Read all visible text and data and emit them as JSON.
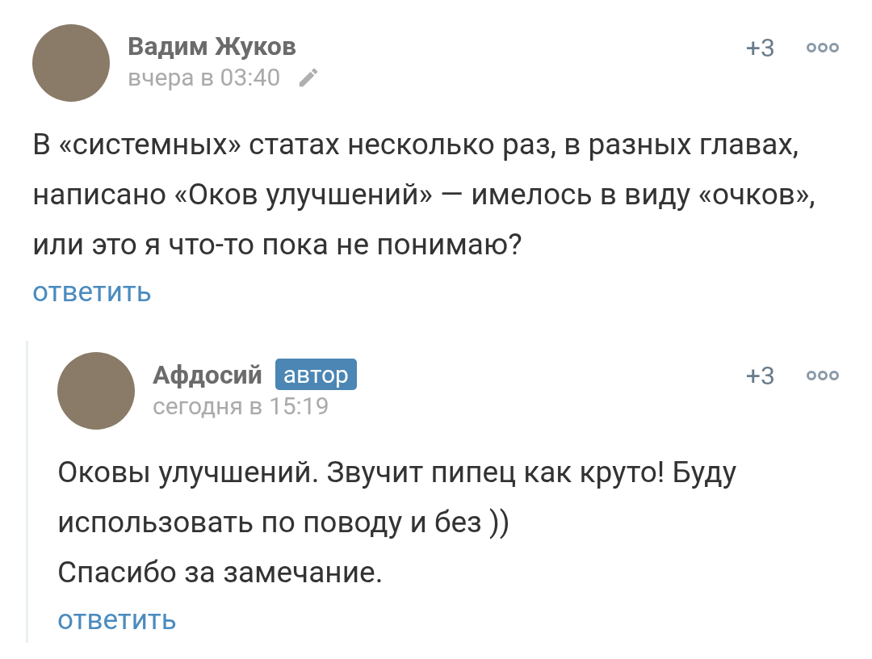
{
  "comments": [
    {
      "author": "Вадим Жуков",
      "time": "вчера в 03:40",
      "edited": true,
      "rating": "+3",
      "body": [
        "В «системных» статах несколько раз, в разных главах, написано «Оков улучшений» — имелось в виду «очков», или это я что-то пока не понимаю?"
      ],
      "reply_link": "ответить",
      "replies": [
        {
          "author": "Афдосий",
          "time": "сегодня в 15:19",
          "edited": false,
          "badge": "автор",
          "rating": "+3",
          "body": [
            "Оковы улучшений. Звучит пипец как круто! Буду использовать по поводу и без ))",
            "Спасибо за замечание."
          ],
          "reply_link": "ответить"
        }
      ]
    }
  ]
}
